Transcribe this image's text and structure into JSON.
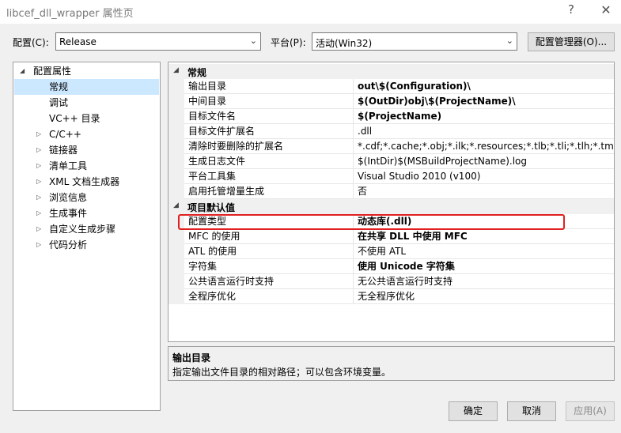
{
  "window": {
    "title": "libcef_dll_wrapper 属性页",
    "help": "?",
    "close": "✕"
  },
  "config": {
    "label": "配置(C):",
    "value": "Release"
  },
  "platform": {
    "label": "平台(P):",
    "value": "活动(Win32)"
  },
  "config_manager_button": "配置管理器(O)...",
  "tree": {
    "root": "配置属性",
    "items": [
      {
        "label": "常规",
        "expandable": false
      },
      {
        "label": "调试",
        "expandable": false
      },
      {
        "label": "VC++ 目录",
        "expandable": false
      },
      {
        "label": "C/C++",
        "expandable": true
      },
      {
        "label": "链接器",
        "expandable": true
      },
      {
        "label": "清单工具",
        "expandable": true
      },
      {
        "label": "XML 文档生成器",
        "expandable": true
      },
      {
        "label": "浏览信息",
        "expandable": true
      },
      {
        "label": "生成事件",
        "expandable": true
      },
      {
        "label": "自定义生成步骤",
        "expandable": true
      },
      {
        "label": "代码分析",
        "expandable": true
      }
    ],
    "selected": "常规"
  },
  "grid": {
    "categories": [
      {
        "name": "常规",
        "rows": [
          {
            "name": "输出目录",
            "value": "out\\$(Configuration)\\",
            "bold": true
          },
          {
            "name": "中间目录",
            "value": "$(OutDir)obj\\$(ProjectName)\\",
            "bold": true
          },
          {
            "name": "目标文件名",
            "value": "$(ProjectName)",
            "bold": true
          },
          {
            "name": "目标文件扩展名",
            "value": ".dll",
            "bold": false
          },
          {
            "name": "清除时要删除的扩展名",
            "value": "*.cdf;*.cache;*.obj;*.ilk;*.resources;*.tlb;*.tli;*.tlh;*.tmp;*.rsp",
            "bold": false
          },
          {
            "name": "生成日志文件",
            "value": "$(IntDir)$(MSBuildProjectName).log",
            "bold": false
          },
          {
            "name": "平台工具集",
            "value": "Visual Studio 2010 (v100)",
            "bold": false
          },
          {
            "name": "启用托管增量生成",
            "value": "否",
            "bold": false
          }
        ]
      },
      {
        "name": "项目默认值",
        "rows": [
          {
            "name": "配置类型",
            "value": "动态库(.dll)",
            "bold": true
          },
          {
            "name": "MFC 的使用",
            "value": "在共享 DLL 中使用 MFC",
            "bold": true
          },
          {
            "name": "ATL 的使用",
            "value": "不使用 ATL",
            "bold": false
          },
          {
            "name": "字符集",
            "value": "使用 Unicode 字符集",
            "bold": true
          },
          {
            "name": "公共语言运行时支持",
            "value": "无公共语言运行时支持",
            "bold": false
          },
          {
            "name": "全程序优化",
            "value": "无全程序优化",
            "bold": false
          }
        ]
      }
    ]
  },
  "description": {
    "title": "输出目录",
    "text": "指定输出文件目录的相对路径；可以包含环境变量。"
  },
  "buttons": {
    "ok": "确定",
    "cancel": "取消",
    "apply": "应用(A)"
  },
  "colors": {
    "highlight_box": "#e02020",
    "selection": "#cce8ff"
  }
}
